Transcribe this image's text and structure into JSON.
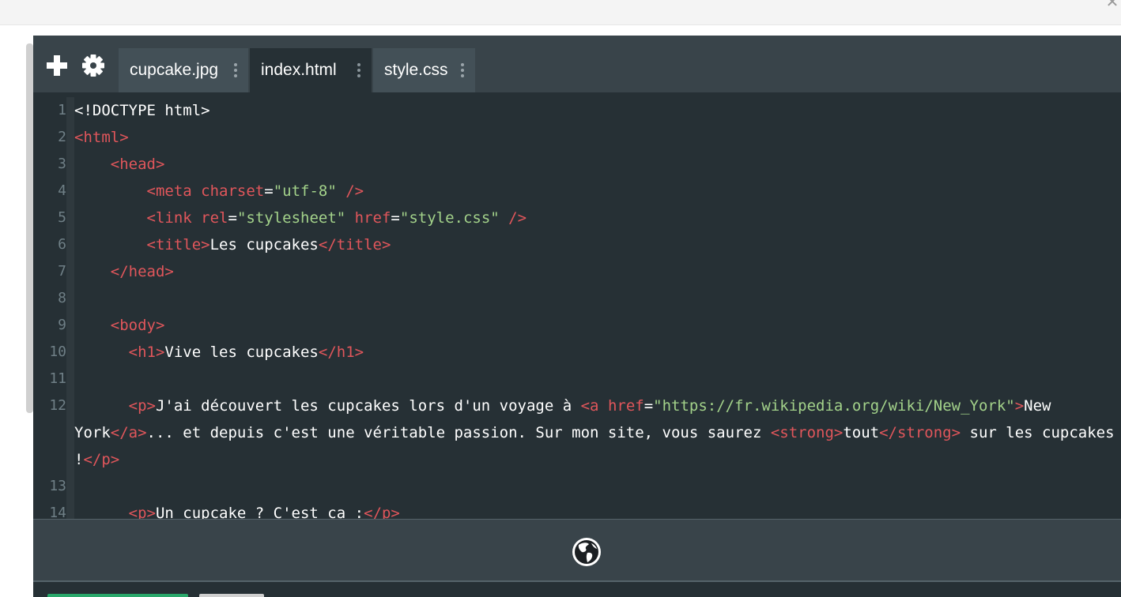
{
  "window": {
    "close_glyph": "✕"
  },
  "toolbar": {
    "add_icon": "plus-icon",
    "settings_icon": "gear-icon",
    "tabs": [
      {
        "label": "cupcake.jpg",
        "active": false
      },
      {
        "label": "index.html",
        "active": true
      },
      {
        "label": "style.css",
        "active": false
      }
    ]
  },
  "code": {
    "lines": [
      {
        "n": "1",
        "spans": [
          [
            "p",
            "<!DOCTYPE html>"
          ]
        ]
      },
      {
        "n": "2",
        "spans": [
          [
            "t",
            "<html>"
          ]
        ]
      },
      {
        "n": "3",
        "spans": [
          [
            "p",
            "    "
          ],
          [
            "t",
            "<head>"
          ]
        ]
      },
      {
        "n": "4",
        "spans": [
          [
            "p",
            "        "
          ],
          [
            "t",
            "<meta "
          ],
          [
            "a",
            "charset"
          ],
          [
            "p",
            "="
          ],
          [
            "s",
            "\"utf-8\""
          ],
          [
            "t",
            " />"
          ]
        ]
      },
      {
        "n": "5",
        "spans": [
          [
            "p",
            "        "
          ],
          [
            "t",
            "<link "
          ],
          [
            "a",
            "rel"
          ],
          [
            "p",
            "="
          ],
          [
            "s",
            "\"stylesheet\""
          ],
          [
            "a",
            " href"
          ],
          [
            "p",
            "="
          ],
          [
            "s",
            "\"style.css\""
          ],
          [
            "t",
            " />"
          ]
        ]
      },
      {
        "n": "6",
        "spans": [
          [
            "p",
            "        "
          ],
          [
            "t",
            "<title>"
          ],
          [
            "p",
            "Les cupcakes"
          ],
          [
            "t",
            "</title>"
          ]
        ]
      },
      {
        "n": "7",
        "spans": [
          [
            "p",
            "    "
          ],
          [
            "t",
            "</head>"
          ]
        ]
      },
      {
        "n": "8",
        "spans": []
      },
      {
        "n": "9",
        "spans": [
          [
            "p",
            "    "
          ],
          [
            "t",
            "<body>"
          ]
        ]
      },
      {
        "n": "10",
        "spans": [
          [
            "p",
            "      "
          ],
          [
            "t",
            "<h1>"
          ],
          [
            "p",
            "Vive les cupcakes"
          ],
          [
            "t",
            "</h1>"
          ]
        ]
      },
      {
        "n": "11",
        "spans": []
      },
      {
        "n": "12",
        "spans": [
          [
            "p",
            "      "
          ],
          [
            "t",
            "<p>"
          ],
          [
            "p",
            "J'ai découvert les cupcakes lors d'un voyage à "
          ],
          [
            "t",
            "<a "
          ],
          [
            "a",
            "href"
          ],
          [
            "p",
            "="
          ],
          [
            "s",
            "\"https://fr.wikipedia.org/wiki/New_York\""
          ],
          [
            "t",
            ">"
          ],
          [
            "p",
            "New York"
          ],
          [
            "t",
            "</a>"
          ],
          [
            "p",
            "... et depuis c'est une véritable passion. Sur mon site, vous saurez "
          ],
          [
            "t",
            "<strong>"
          ],
          [
            "p",
            "tout"
          ],
          [
            "t",
            "</strong>"
          ],
          [
            "p",
            " sur les cupcakes !"
          ],
          [
            "t",
            "</p>"
          ]
        ]
      },
      {
        "n": "13",
        "spans": []
      },
      {
        "n": "14",
        "spans": [
          [
            "p",
            "      "
          ],
          [
            "t",
            "<p>"
          ],
          [
            "p",
            "Un cupcake ? C'est ca :"
          ],
          [
            "t",
            "</p>"
          ]
        ]
      }
    ]
  },
  "bottombar": {
    "preview_icon": "globe-icon"
  },
  "colors": {
    "editor_bg": "#263035",
    "toolbar_bg": "#39444a",
    "tag": "#e0565b",
    "string": "#a3d28a",
    "line_number": "#6f7f86",
    "accent_green": "#2aa86b"
  }
}
